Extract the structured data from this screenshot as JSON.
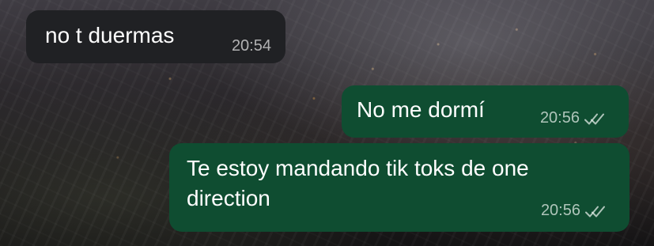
{
  "conversation": {
    "messages": [
      {
        "direction": "incoming",
        "text": "no t duermas",
        "time": "20:54"
      },
      {
        "direction": "outgoing",
        "text": "No me dormí",
        "time": "20:56",
        "status_icon": "double-check-icon"
      },
      {
        "direction": "outgoing",
        "text_lines": [
          "Te estoy mandando tik toks de one",
          "direction"
        ],
        "time": "20:56",
        "status_icon": "double-check-icon"
      }
    ]
  }
}
